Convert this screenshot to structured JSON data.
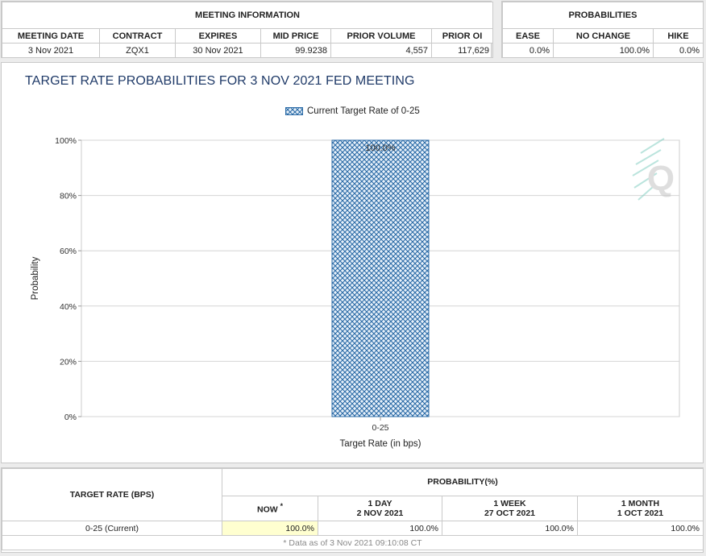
{
  "meeting_info": {
    "header": "MEETING INFORMATION",
    "columns": [
      "MEETING DATE",
      "CONTRACT",
      "EXPIRES",
      "MID PRICE",
      "PRIOR VOLUME",
      "PRIOR OI"
    ],
    "row": [
      "3 Nov 2021",
      "ZQX1",
      "30 Nov 2021",
      "99.9238",
      "4,557",
      "117,629"
    ]
  },
  "probabilities": {
    "header": "PROBABILITIES",
    "columns": [
      "EASE",
      "NO CHANGE",
      "HIKE"
    ],
    "row": [
      "0.0%",
      "100.0%",
      "0.0%"
    ]
  },
  "chart": {
    "title": "TARGET RATE PROBABILITIES FOR 3 NOV 2021 FED MEETING",
    "legend": "Current Target Rate of 0-25",
    "watermark": "Q"
  },
  "chart_data": {
    "type": "bar",
    "categories": [
      "0-25"
    ],
    "values": [
      100.0
    ],
    "data_labels": [
      "100.0%"
    ],
    "title": "TARGET RATE PROBABILITIES FOR 3 NOV 2021 FED MEETING",
    "xlabel": "Target Rate (in bps)",
    "ylabel": "Probability",
    "ylim": [
      0,
      100
    ],
    "yticks": [
      "0%",
      "20%",
      "40%",
      "60%",
      "80%",
      "100%"
    ],
    "grid": true,
    "legend_position": "top-center",
    "series": [
      {
        "name": "Current Target Rate of 0-25",
        "values": [
          100.0
        ]
      }
    ],
    "colors": {
      "bar": "#2a6aa6",
      "bar_fill": "#e8f1fa"
    }
  },
  "bottom_table": {
    "target_rate_header": "TARGET RATE (BPS)",
    "probability_header": "PROBABILITY(%)",
    "now_label": "NOW",
    "now_marker": "*",
    "cols": [
      {
        "line1": "1 DAY",
        "line2": "2 NOV 2021"
      },
      {
        "line1": "1 WEEK",
        "line2": "27 OCT 2021"
      },
      {
        "line1": "1 MONTH",
        "line2": "1 OCT 2021"
      }
    ],
    "row": {
      "rate": "0-25 (Current)",
      "now": "100.0%",
      "day": "100.0%",
      "week": "100.0%",
      "month": "100.0%"
    },
    "footnote": "* Data as of 3 Nov 2021 09:10:08 CT"
  }
}
